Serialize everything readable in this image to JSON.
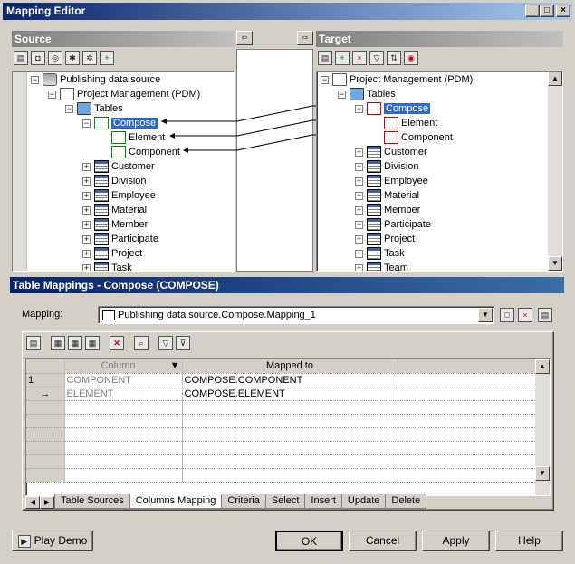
{
  "window": {
    "title": "Mapping Editor",
    "min": "_",
    "max": "□",
    "close": "×"
  },
  "source": {
    "header": "Source",
    "tree": [
      {
        "label": "Publishing data source",
        "level": 0,
        "expander": "−",
        "icon": "database-icon"
      },
      {
        "label": "Project Management (PDM)",
        "level": 1,
        "expander": "−",
        "icon": "model-icon"
      },
      {
        "label": "Tables",
        "level": 2,
        "expander": "−",
        "icon": "folder-icon"
      },
      {
        "label": "Compose",
        "level": 3,
        "expander": "−",
        "icon": "table-link-icon",
        "selected": true
      },
      {
        "label": "Element",
        "level": 4,
        "expander": "",
        "icon": "column-link-icon"
      },
      {
        "label": "Component",
        "level": 4,
        "expander": "",
        "icon": "column-link-icon"
      },
      {
        "label": "Customer",
        "level": 3,
        "expander": "+",
        "icon": "table-icon"
      },
      {
        "label": "Division",
        "level": 3,
        "expander": "+",
        "icon": "table-icon"
      },
      {
        "label": "Employee",
        "level": 3,
        "expander": "+",
        "icon": "table-icon"
      },
      {
        "label": "Material",
        "level": 3,
        "expander": "+",
        "icon": "table-icon"
      },
      {
        "label": "Member",
        "level": 3,
        "expander": "+",
        "icon": "table-icon"
      },
      {
        "label": "Participate",
        "level": 3,
        "expander": "+",
        "icon": "table-icon"
      },
      {
        "label": "Project",
        "level": 3,
        "expander": "+",
        "icon": "table-icon"
      },
      {
        "label": "Task",
        "level": 3,
        "expander": "+",
        "icon": "table-icon"
      }
    ]
  },
  "middle": {
    "left_arrow": "⇦",
    "right_arrow": "⇨"
  },
  "target": {
    "header": "Target",
    "tree": [
      {
        "label": "Project Management (PDM)",
        "level": 0,
        "expander": "−",
        "icon": "model-icon"
      },
      {
        "label": "Tables",
        "level": 1,
        "expander": "−",
        "icon": "folder-icon"
      },
      {
        "label": "Compose",
        "level": 2,
        "expander": "−",
        "icon": "table-mapped-icon",
        "selected": true
      },
      {
        "label": "Element",
        "level": 3,
        "expander": "",
        "icon": "column-mapped-icon"
      },
      {
        "label": "Component",
        "level": 3,
        "expander": "",
        "icon": "column-mapped-icon"
      },
      {
        "label": "Customer",
        "level": 2,
        "expander": "+",
        "icon": "table-icon"
      },
      {
        "label": "Division",
        "level": 2,
        "expander": "+",
        "icon": "table-icon"
      },
      {
        "label": "Employee",
        "level": 2,
        "expander": "+",
        "icon": "table-icon"
      },
      {
        "label": "Material",
        "level": 2,
        "expander": "+",
        "icon": "table-icon"
      },
      {
        "label": "Member",
        "level": 2,
        "expander": "+",
        "icon": "table-icon"
      },
      {
        "label": "Participate",
        "level": 2,
        "expander": "+",
        "icon": "table-icon"
      },
      {
        "label": "Project",
        "level": 2,
        "expander": "+",
        "icon": "table-icon"
      },
      {
        "label": "Task",
        "level": 2,
        "expander": "+",
        "icon": "table-icon"
      },
      {
        "label": "Team",
        "level": 2,
        "expander": "+",
        "icon": "table-icon"
      }
    ]
  },
  "mappings": {
    "header": "Table Mappings - Compose (COMPOSE)",
    "mapping_label": "Mapping:",
    "mapping_value": "Publishing data source.Compose.Mapping_1",
    "grid": {
      "col_header": "Column",
      "mapped_header": "Mapped to",
      "rows": [
        {
          "num": "1",
          "column": "COMPONENT",
          "mapped": "COMPOSE.COMPONENT"
        },
        {
          "num": "→",
          "column": "ELEMENT",
          "mapped": "COMPOSE.ELEMENT"
        }
      ]
    },
    "tabs": [
      "Table Sources",
      "Columns Mapping",
      "Criteria",
      "Select",
      "Insert",
      "Update",
      "Delete"
    ],
    "active_tab": "Columns Mapping"
  },
  "buttons": {
    "play_demo": "Play Demo",
    "ok": "OK",
    "cancel": "Cancel",
    "apply": "Apply",
    "help": "Help"
  }
}
